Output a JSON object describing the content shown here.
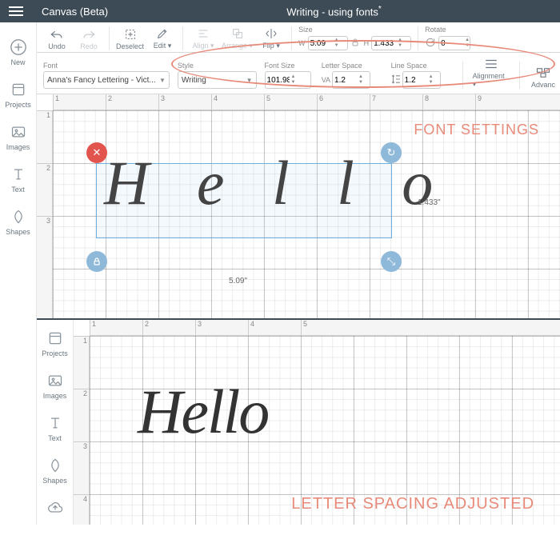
{
  "topbar": {
    "app": "Canvas (Beta)",
    "doc": "Writing - using fonts",
    "dirty": "*"
  },
  "sidebar": {
    "new": "New",
    "projects": "Projects",
    "images": "Images",
    "text": "Text",
    "shapes": "Shapes",
    "upload": "Upload"
  },
  "toolbar": {
    "undo": "Undo",
    "redo": "Redo",
    "deselect": "Deselect",
    "edit": "Edit",
    "align": "Align",
    "arrange": "Arrange",
    "flip": "Flip",
    "size": "Size",
    "w_label": "W",
    "w": "5.09",
    "h_label": "H",
    "h": "1.433",
    "rotate": "Rotate",
    "rotate_deg": "0"
  },
  "fontbar": {
    "font_h": "Font",
    "font": "Anna's Fancy Lettering - Vict...",
    "style_h": "Style",
    "style": "Writing",
    "fontsize_h": "Font Size",
    "fontsize": "101.98",
    "letter_h": "Letter Space",
    "letter": "1.2",
    "letter_ico": "VA",
    "line_h": "Line Space",
    "line": "1.2",
    "alignment": "Alignment",
    "advanced": "Advanc"
  },
  "canvas1": {
    "text": "H e l l o",
    "wlabel": "5.09\"",
    "hlabel": "1.433\"",
    "ruler_h": [
      "1",
      "2",
      "3",
      "4",
      "5",
      "6",
      "7",
      "8",
      "9"
    ],
    "ruler_v": [
      "1",
      "2",
      "3"
    ],
    "anno": "FONT SETTINGS"
  },
  "canvas2": {
    "text": "Hello",
    "ruler_h": [
      "1",
      "2",
      "3",
      "4",
      "5"
    ],
    "ruler_v": [
      "1",
      "2",
      "3",
      "4"
    ],
    "anno": "LETTER SPACING ADJUSTED"
  }
}
